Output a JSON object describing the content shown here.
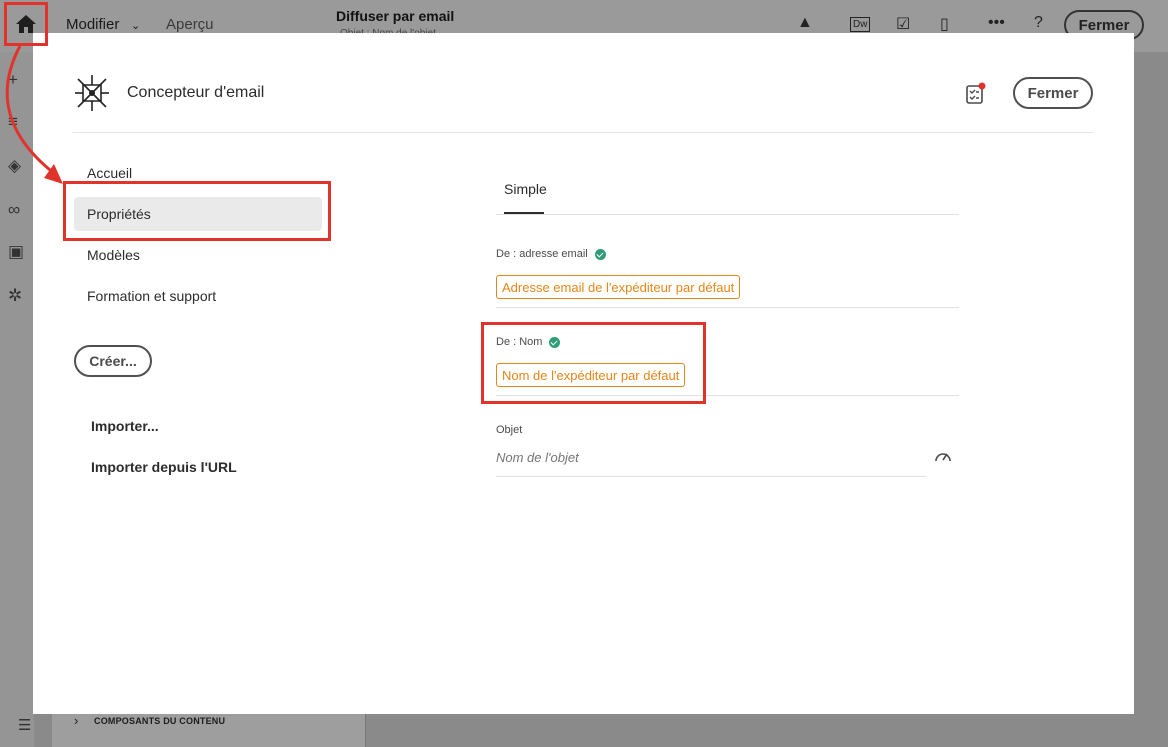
{
  "background_app": {
    "edit_menu": "Modifier",
    "preview": "Aperçu",
    "title": "Diffuser par email",
    "subtitle": "Objet : Nom de l'objet",
    "close_label": "Fermer",
    "bottom_panel_label": "COMPOSANTS DU CONTENU"
  },
  "modal": {
    "app_title": "Concepteur d'email",
    "close_label": "Fermer",
    "nav": [
      {
        "label": "Accueil",
        "active": false
      },
      {
        "label": "Propriétés",
        "active": true
      },
      {
        "label": "Modèles",
        "active": false
      },
      {
        "label": "Formation et support",
        "active": false
      }
    ],
    "create_label": "Créer...",
    "import_label": "Importer...",
    "import_url_label": "Importer depuis l'URL",
    "tab_simple": "Simple",
    "from_email": {
      "label": "De : adresse email",
      "value": "Adresse email de l'expéditeur par défaut"
    },
    "from_name": {
      "label": "De : Nom",
      "value": "Nom de l'expéditeur par défaut"
    },
    "subject": {
      "label": "Objet",
      "placeholder": "Nom de l'objet"
    }
  },
  "colors": {
    "accent_orange": "#e68619",
    "highlight_red": "#e0332b",
    "valid_green": "#2d9d78"
  }
}
